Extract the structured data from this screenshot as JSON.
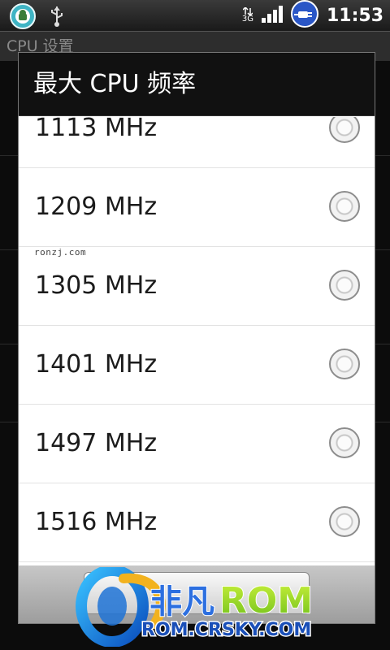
{
  "status_bar": {
    "network_label": "3G",
    "time": "11:53"
  },
  "background_screen": {
    "title": "CPU 设置"
  },
  "dialog": {
    "title": "最大 CPU 频率",
    "options": [
      {
        "label": "1113 MHz",
        "selected": false
      },
      {
        "label": "1209 MHz",
        "selected": false
      },
      {
        "label": "1305 MHz",
        "selected": false
      },
      {
        "label": "1401 MHz",
        "selected": false
      },
      {
        "label": "1497 MHz",
        "selected": false
      },
      {
        "label": "1516 MHz",
        "selected": false
      }
    ]
  },
  "watermarks": {
    "site_small": "ronzj.com",
    "brand_cn": "非凡",
    "brand_rom": "ROM",
    "brand_url": "ROM.CRSKY.COM"
  }
}
